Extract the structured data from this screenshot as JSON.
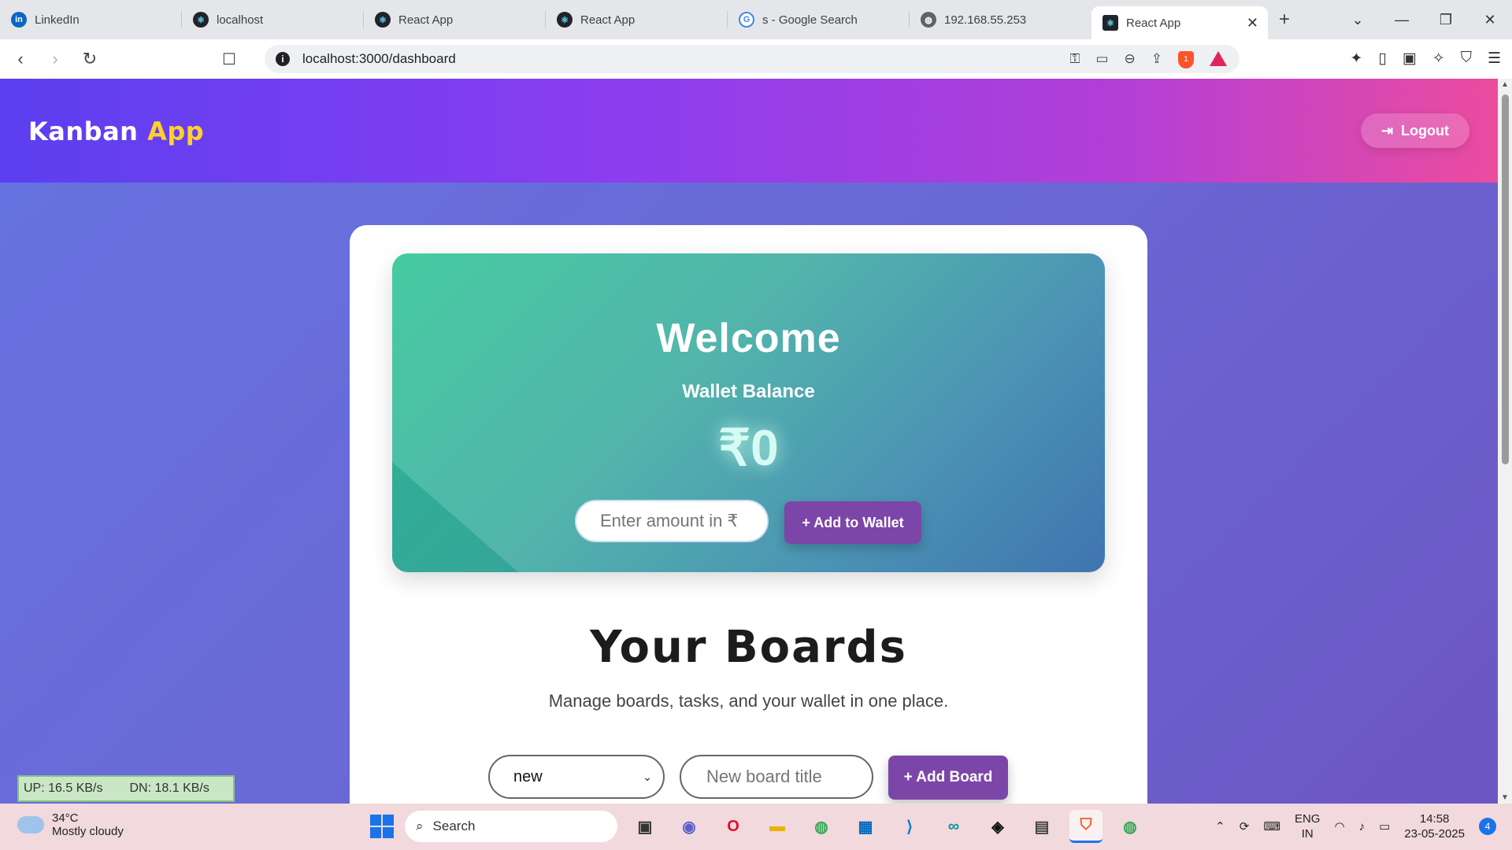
{
  "browser": {
    "tabs": [
      {
        "title": "LinkedIn",
        "favicon": "linkedin-icon",
        "color": "#0a66c2",
        "active": false
      },
      {
        "title": "localhost",
        "favicon": "react-icon",
        "color": "#20232a",
        "active": false
      },
      {
        "title": "React App",
        "favicon": "react-icon",
        "color": "#20232a",
        "active": false
      },
      {
        "title": "React App",
        "favicon": "react-icon",
        "color": "#20232a",
        "active": false
      },
      {
        "title": "s - Google Search",
        "favicon": "google-icon",
        "color": "#4285f4",
        "active": false
      },
      {
        "title": "192.168.55.253",
        "favicon": "globe-icon",
        "color": "#5f6368",
        "active": false
      },
      {
        "title": "React App",
        "favicon": "react-icon",
        "color": "#20232a",
        "active": true
      }
    ],
    "url": "localhost:3000/dashboard",
    "shield_count": "1"
  },
  "app": {
    "brand_main": "Kanban",
    "brand_accent": "App",
    "logout_label": "Logout",
    "welcome": "Welcome",
    "wallet_label": "Wallet Balance",
    "wallet_amount": "₹0",
    "amount_placeholder": "Enter amount in ₹",
    "add_wallet_label": "+ Add to Wallet",
    "boards_title": "Your Boards",
    "boards_subtitle": "Manage boards, tasks, and your wallet in one place.",
    "board_select_value": "new",
    "board_title_placeholder": "New board title",
    "add_board_label": "+ Add Board"
  },
  "netmeter": {
    "up": "UP: 16.5 KB/s",
    "down": "DN: 18.1 KB/s"
  },
  "taskbar": {
    "temperature": "34°C",
    "weather": "Mostly cloudy",
    "search_label": "Search",
    "lang_line1": "ENG",
    "lang_line2": "IN",
    "time": "14:58",
    "date": "23-05-2025",
    "notification_count": "4"
  },
  "colors": {
    "brand_accent": "#ffd02e",
    "button_purple": "#7c46a8"
  }
}
